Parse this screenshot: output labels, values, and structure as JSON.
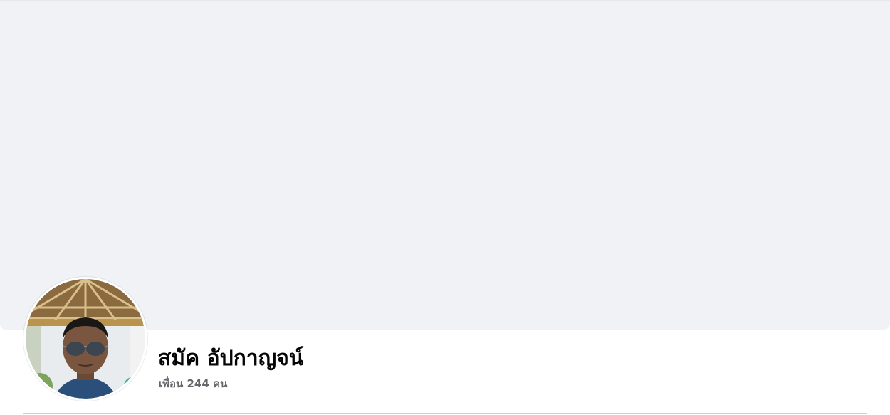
{
  "profile": {
    "name": "สมัค อัปกาญจน์",
    "friends_text": "เพื่อน 244 คน"
  },
  "colors": {
    "cover_background": "#f0f2f5",
    "name_text": "#050505",
    "secondary_text": "#65676b",
    "divider": "#ced0d4"
  }
}
